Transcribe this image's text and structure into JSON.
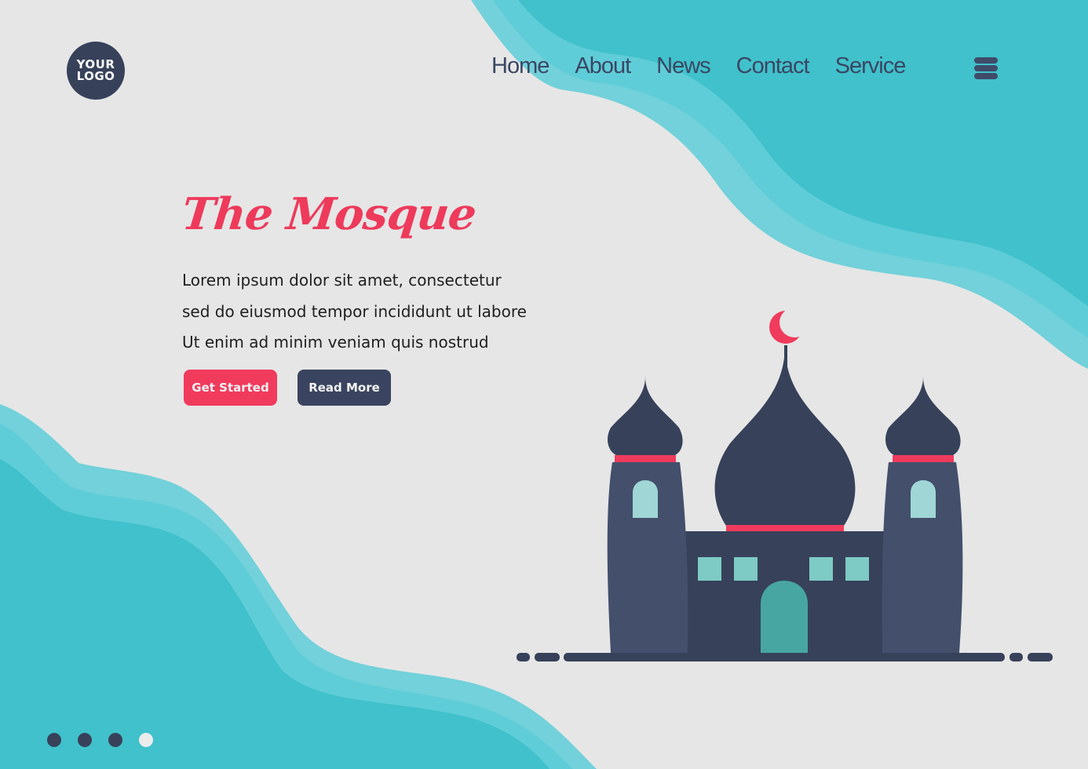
{
  "logo": {
    "line1": "YOUR",
    "line2": "LOGO"
  },
  "nav": {
    "items": [
      {
        "label": "Home"
      },
      {
        "label": "About"
      },
      {
        "label": "News"
      },
      {
        "label": "Contact"
      },
      {
        "label": "Service"
      }
    ],
    "menu_icon": "hamburger-menu-icon"
  },
  "hero": {
    "title": "The Mosque",
    "description": [
      "Lorem ipsum dolor sit amet, consectetur",
      "sed do eiusmod tempor incididunt ut labore",
      "Ut enim ad minim veniam quis nostrud"
    ],
    "primary_button": "Get Started",
    "secondary_button": "Read More"
  },
  "pagination": {
    "total": 4,
    "active_index": 3
  },
  "colors": {
    "accent": "#f03b5d",
    "dark": "#37415a",
    "teal": "#40c1cb",
    "teal_light": "#62ced8",
    "background": "#e6e6e6"
  },
  "illustration": {
    "name": "mosque-illustration",
    "crescent": "crescent-moon-icon"
  }
}
